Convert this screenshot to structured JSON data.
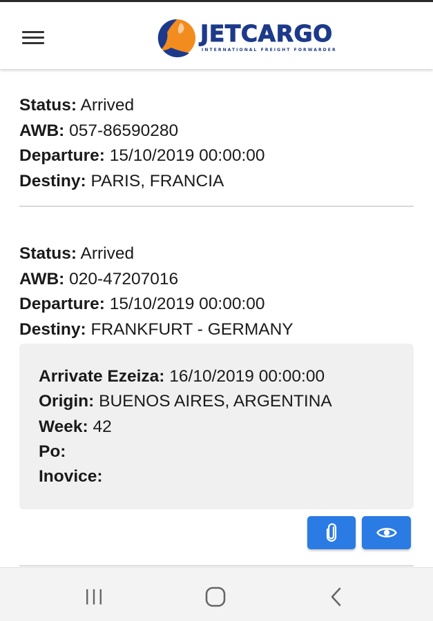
{
  "app": {
    "logo_text": "JETCARGO",
    "logo_tagline": "INTERNATIONAL FREIGHT FORWARDER",
    "brand_color": "#1d3a8a",
    "accent_color": "#f28c1e"
  },
  "shipments": [
    {
      "status_label": "Status:",
      "status": "Arrived",
      "awb_label": "AWB:",
      "awb": "057-86590280",
      "departure_label": "Departure:",
      "departure": "15/10/2019 00:00:00",
      "destiny_label": "Destiny:",
      "destiny": "PARIS, FRANCIA"
    },
    {
      "status_label": "Status:",
      "status": "Arrived",
      "awb_label": "AWB:",
      "awb": "020-47207016",
      "departure_label": "Departure:",
      "departure": "15/10/2019 00:00:00",
      "destiny_label": "Destiny:",
      "destiny": "FRANKFURT - GERMANY",
      "details": {
        "arrival_label": "Arrivate Ezeiza:",
        "arrival": "16/10/2019 00:00:00",
        "origin_label": "Origin:",
        "origin": "BUENOS AIRES, ARGENTINA",
        "week_label": "Week:",
        "week": "42",
        "po_label": "Po:",
        "po": "",
        "invoice_label": "Inovice:",
        "invoice": ""
      },
      "actions": [
        {
          "icon": "paperclip-icon"
        },
        {
          "icon": "eye-icon"
        }
      ]
    }
  ],
  "colors": {
    "button": "#2a7be4",
    "details_bg": "#f0f0f0"
  },
  "navbar": {
    "icons": [
      "recents-icon",
      "home-icon",
      "back-icon"
    ]
  }
}
